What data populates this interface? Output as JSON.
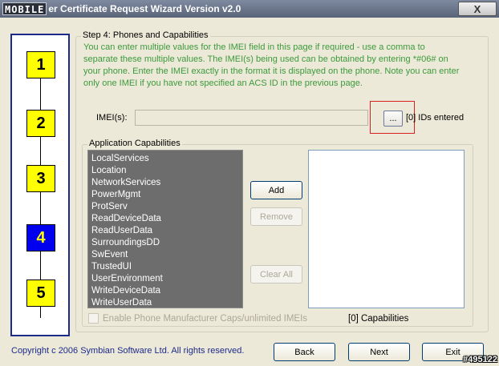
{
  "window": {
    "logo_text": "MOBILE",
    "title": "er Certificate Request Wizard Version v2.0",
    "close_label": "X"
  },
  "steps": [
    {
      "label": "1",
      "state": "inactive"
    },
    {
      "label": "2",
      "state": "inactive"
    },
    {
      "label": "3",
      "state": "inactive"
    },
    {
      "label": "4",
      "state": "active"
    },
    {
      "label": "5",
      "state": "inactive"
    }
  ],
  "page": {
    "group_title": "Step 4: Phones and Capabilities",
    "instructions": "You can enter multiple values for the IMEI field in this page if required - use a comma to separate these multiple values. The IMEI(s) being used can be obtained by entering *#06# on your phone. Enter the IMEI exactly in the format it is displayed on the phone. Note you can enter only one IMEI if you have not specified an ACS ID in the previous page.",
    "imei_label": "IMEI(s):",
    "imei_value": "",
    "browse_label": "...",
    "ids_entered": "[0] IDs entered"
  },
  "capabilities": {
    "group_title": "Application Capabilities",
    "available": [
      "LocalServices",
      "Location",
      "NetworkServices",
      "PowerMgmt",
      "ProtServ",
      "ReadDeviceData",
      "ReadUserData",
      "SurroundingsDD",
      "SwEvent",
      "TrustedUI",
      "UserEnvironment",
      "WriteDeviceData",
      "WriteUserData"
    ],
    "add_label": "Add",
    "remove_label": "Remove",
    "clear_all_label": "Clear All",
    "count_label": "[0] Capabilities",
    "enable_label": "Enable Phone Manufacturer Caps/unlimited IMEIs"
  },
  "footer": {
    "copyright": "Copyright c 2006 Symbian Software Ltd. All rights reserved.",
    "back_label": "Back",
    "next_label": "Next",
    "exit_label": "Exit",
    "watermark": "#495122"
  }
}
